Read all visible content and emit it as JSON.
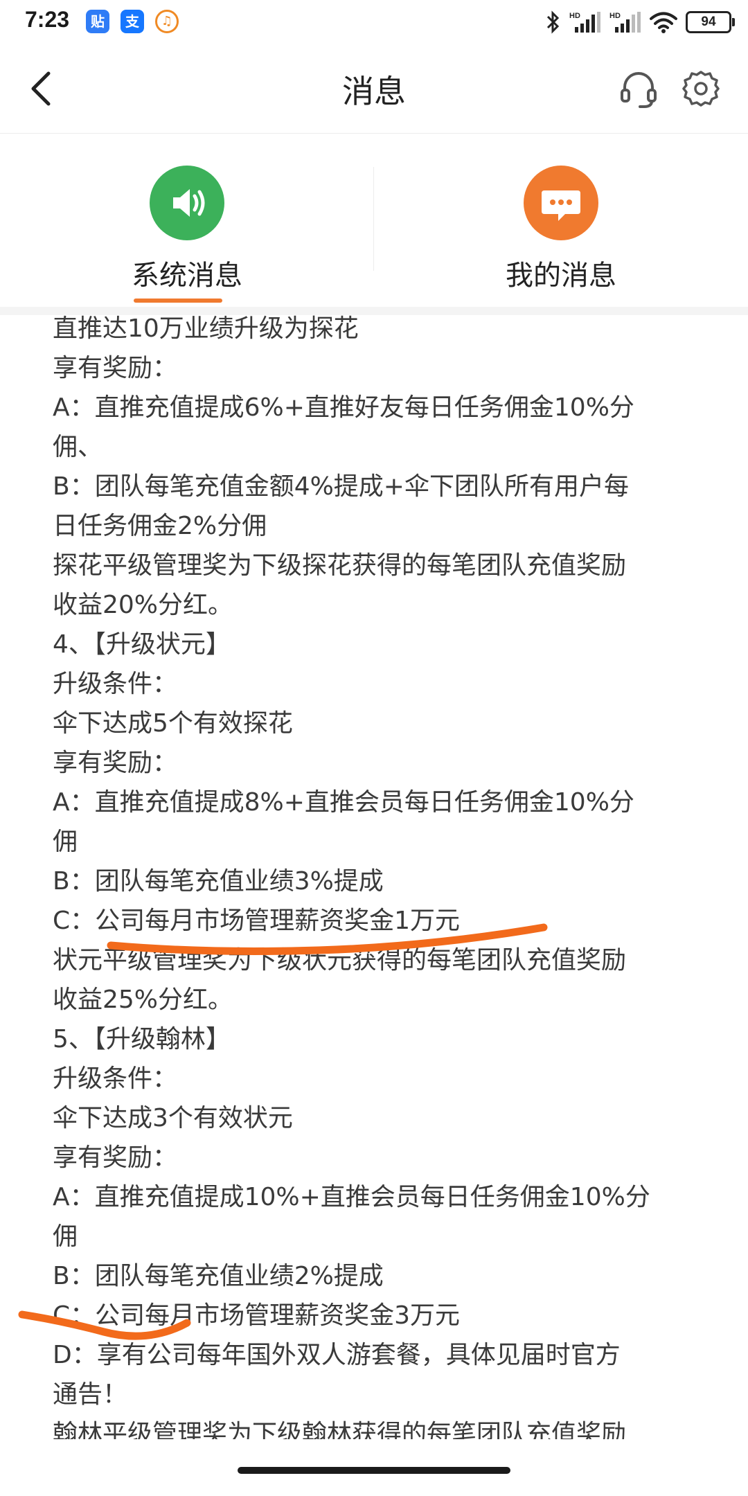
{
  "status_bar": {
    "time": "7:23",
    "apps": [
      {
        "glyph": "贴",
        "color": "#2f7cf6"
      },
      {
        "glyph": "支",
        "color": "#1677ff"
      },
      {
        "glyph": "♫",
        "color": "#f08a24"
      }
    ],
    "battery": "94",
    "icons": [
      "bluetooth-icon",
      "hd-signal-icon",
      "hd-signal-icon",
      "wifi-icon"
    ]
  },
  "header": {
    "title": "消息"
  },
  "tabs": [
    {
      "label": "系统消息",
      "color": "#3cb15a",
      "icon": "speaker-icon",
      "active": true
    },
    {
      "label": "我的消息",
      "color": "#f07a2f",
      "icon": "chat-bubble-icon",
      "active": false
    }
  ],
  "message": {
    "lines": [
      "直推达10万业绩升级为探花",
      "享有奖励：",
      "A：直推充值提成6%+直推好友每日任务佣金10%分",
      "佣、",
      "B：团队每笔充值金额4%提成+伞下团队所有用户每",
      "日任务佣金2%分佣",
      "探花平级管理奖为下级探花获得的每笔团队充值奖励",
      "收益20%分红。",
      "4、【升级状元】",
      "升级条件：",
      "伞下达成5个有效探花",
      "享有奖励：",
      "A：直推充值提成8%+直推会员每日任务佣金10%分",
      "佣",
      "B：团队每笔充值业绩3%提成",
      "C：公司每月市场管理薪资奖金1万元",
      "状元平级管理奖为下级状元获得的每笔团队充值奖励",
      "收益25%分红。",
      "5、【升级翰林】",
      "升级条件：",
      "伞下达成3个有效状元",
      "享有奖励：",
      "A：直推充值提成10%+直推会员每日任务佣金10%分",
      "佣",
      "B：团队每笔充值业绩2%提成",
      "C：公司每月市场管理薪资奖金3万元",
      "D：享有公司每年国外双人游套餐，具体见届时官方",
      "通告！",
      "翰林平级管理奖为下级翰林获得的每笔团队充值奖励"
    ]
  },
  "annotation_color": "#f26a1b"
}
